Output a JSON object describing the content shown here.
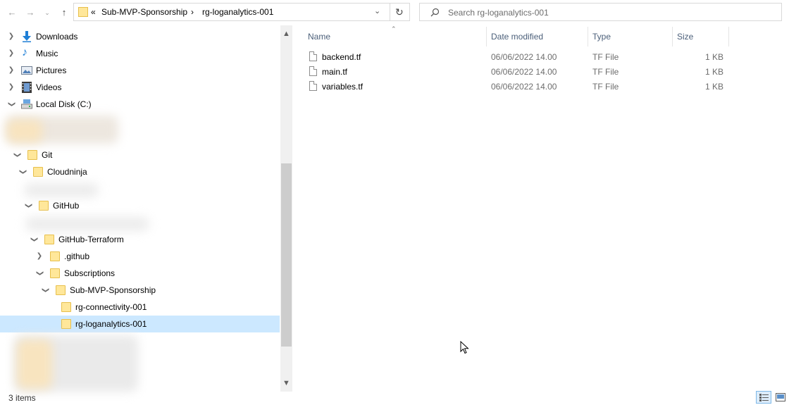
{
  "address_bar": {
    "overflow_glyph": "«",
    "crumbs": [
      "Sub-MVP-Sponsorship",
      "rg-loganalytics-001"
    ],
    "crumb_separator": "›"
  },
  "search": {
    "placeholder": "Search rg-loganalytics-001"
  },
  "tree": {
    "items": [
      {
        "label": "Downloads",
        "icon": "downloads-icon"
      },
      {
        "label": "Music",
        "icon": "music-icon"
      },
      {
        "label": "Pictures",
        "icon": "pictures-icon"
      },
      {
        "label": "Videos",
        "icon": "videos-icon"
      },
      {
        "label": "Local Disk (C:)",
        "icon": "drive-icon"
      },
      {
        "label": "Git",
        "icon": "folder-icon"
      },
      {
        "label": "Cloudninja",
        "icon": "folder-icon"
      },
      {
        "label": "GitHub",
        "icon": "folder-icon"
      },
      {
        "label": "GitHub-Terraform",
        "icon": "folder-icon"
      },
      {
        "label": ".github",
        "icon": "folder-icon"
      },
      {
        "label": "Subscriptions",
        "icon": "folder-icon"
      },
      {
        "label": "Sub-MVP-Sponsorship",
        "icon": "folder-icon"
      },
      {
        "label": "rg-connectivity-001",
        "icon": "folder-icon"
      },
      {
        "label": "rg-loganalytics-001",
        "icon": "folder-icon",
        "selected": true
      }
    ]
  },
  "file_list": {
    "columns": [
      "Name",
      "Date modified",
      "Type",
      "Size"
    ],
    "rows": [
      {
        "name": "backend.tf",
        "date": "06/06/2022 14.00",
        "type": "TF File",
        "size": "1 KB"
      },
      {
        "name": "main.tf",
        "date": "06/06/2022 14.00",
        "type": "TF File",
        "size": "1 KB"
      },
      {
        "name": "variables.tf",
        "date": "06/06/2022 14.00",
        "type": "TF File",
        "size": "1 KB"
      }
    ]
  },
  "status_bar": {
    "item_count": "3 items"
  },
  "colors": {
    "selection": "#cce8ff",
    "folder": "#ffe79a",
    "header_text": "#4c607a"
  }
}
